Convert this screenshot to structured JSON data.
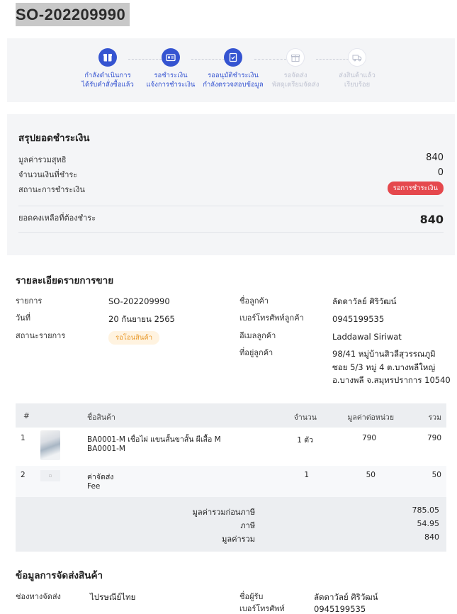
{
  "order": {
    "id": "SO-202209990"
  },
  "steps": [
    {
      "l1": "กำลังดำเนินการ",
      "l2": "ได้รับคำสั่งซื้อแล้ว",
      "icon": "box-icon",
      "done": true
    },
    {
      "l1": "รอชำระเงิน",
      "l2": "แจ้งการชำระเงิน",
      "icon": "id-card-icon",
      "done": true
    },
    {
      "l1": "รออนุมัติชำระเงิน",
      "l2": "กำลังตรวจสอบข้อมูล",
      "icon": "check-doc-icon",
      "done": true
    },
    {
      "l1": "รอจัดส่ง",
      "l2": "พัสดุเตรียมจัดส่ง",
      "icon": "gift-box-icon",
      "done": false
    },
    {
      "l1": "ส่งสินค้าแล้ว",
      "l2": "เรียบร้อย",
      "icon": "truck-icon",
      "done": false
    }
  ],
  "summary": {
    "title": "สรุปยอดชำระเงิน",
    "net_label": "มูลค่ารวมสุทธิ",
    "net_value": "840",
    "paid_label": "จำนวนเงินที่ชำระ",
    "paid_value": "0",
    "status_label": "สถานะการชำระเงิน",
    "status_badge": "รอการชำระเงิน",
    "balance_label": "ยอดคงเหลือที่ต้องชำระ",
    "balance_value": "840"
  },
  "details": {
    "title": "รายละเอียดรายการขาย",
    "item_label": "รายการ",
    "item_value": "SO-202209990",
    "date_label": "วันที่",
    "date_value": "20 กันยายน 2565",
    "status_label": "สถานะรายการ",
    "status_badge": "รอโอนสินค้า",
    "customer_label": "ชื่อลูกค้า",
    "customer_value": "ลัดดาวัลย์ ศิริวัฒน์",
    "phone_label": "เบอร์โทรศัพท์ลูกค้า",
    "phone_value": "0945199535",
    "email_label": "อีเมลลูกค้า",
    "email_value": "Laddawal Siriwat",
    "address_label": "ที่อยู่ลูกค้า",
    "address_line1": "98/41 หมู่บ้านสิวลีสุวรรณภูมิ",
    "address_line2": "ซอย 5/3 หมู่ 4 ต.บางพลีใหญ่",
    "address_line3": "อ.บางพลี จ.สมุทรปราการ 10540"
  },
  "table": {
    "headers": {
      "no": "#",
      "name": "ชื่อสินค้า",
      "qty": "จำนวน",
      "unit": "มูลค่าต่อหน่วย",
      "total": "รวม"
    },
    "rows": [
      {
        "no": "1",
        "name": "BA0001-M เชื่อไผ่ แขนสั้นขาสั้น ผีเสื้อ M",
        "code": "BA0001-M",
        "qty": "1 ตัว",
        "unit": "790",
        "total": "790"
      },
      {
        "no": "2",
        "name": "ค่าจัดส่ง",
        "code": "Fee",
        "qty": "1",
        "unit": "50",
        "total": "50"
      }
    ],
    "subtotal_label": "มูลค่ารวมก่อนภาษี",
    "subtotal_value": "785.05",
    "tax_label": "ภาษี",
    "tax_value": "54.95",
    "grand_label": "มูลค่ารวม",
    "grand_value": "840"
  },
  "shipping": {
    "title": "ข้อมูลการจัดส่งสินค้า",
    "channel_label": "ช่องทางจัดส่ง",
    "channel_value": "ไปรษณีย์ไทย",
    "recipient_label": "ชื่อผู้รับ",
    "recipient_value": "ลัดดาวัลย์ ศิริวัฒน์",
    "phone_label": "เบอร์โทรศัพท์",
    "phone_value": "0945199535"
  },
  "colors": {
    "accent": "#3554d1",
    "danger": "#e5484d",
    "warning": "#e89a2c"
  }
}
